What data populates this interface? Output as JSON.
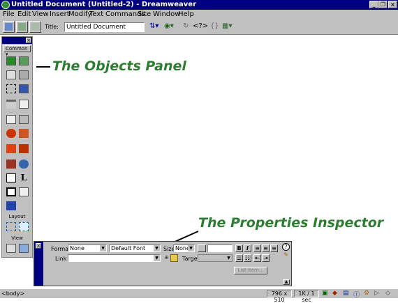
{
  "window": {
    "title": "Untitled Document (Untitled-2) - Dreamweaver"
  },
  "menu": [
    "File",
    "Edit",
    "View",
    "Insert",
    "Modify",
    "Text",
    "Commands",
    "Site",
    "Window",
    "Help"
  ],
  "toolbar": {
    "title_label": "Title:",
    "title_value": "Untitled Document",
    "code_brackets": "<?>",
    "curly_braces": "{}"
  },
  "objects_panel": {
    "category": "Common",
    "layout_label": "Layout",
    "view_label": "View",
    "glyph_L": "L"
  },
  "annotations": {
    "objects_panel": "The Objects Panel",
    "properties_inspector": "The Properties Inspector"
  },
  "properties": {
    "format_label": "Format",
    "format_value": "None",
    "font_value": "Default Font",
    "size_label": "Size",
    "size_value": "None",
    "bold": "B",
    "italic": "I",
    "link_label": "Link",
    "target_label": "Target",
    "list_item_button": "List Item...",
    "help": "?"
  },
  "status": {
    "tag": "<body>",
    "dimensions": "796 x 510",
    "download": "1K / 1 sec"
  },
  "colors": {
    "title_bar": "#000080",
    "chrome": "#c0c0c0",
    "annotation": "#2e7d32"
  }
}
